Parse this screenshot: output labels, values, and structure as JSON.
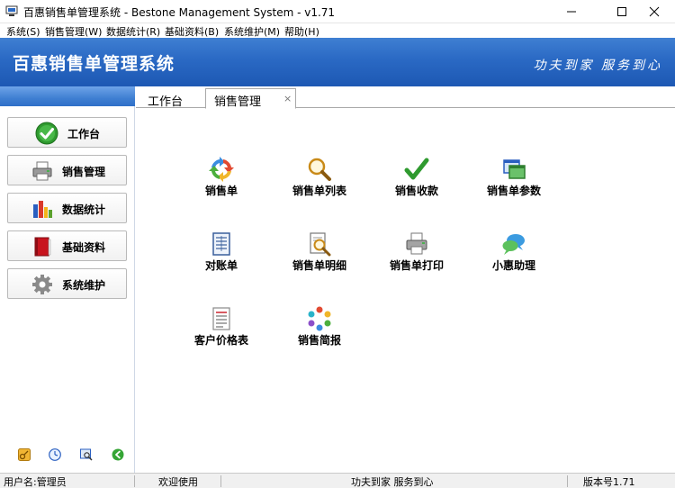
{
  "window": {
    "title": "百惠销售单管理系统 - Bestone Management System - v1.71",
    "minimize_icon": "minimize-icon",
    "maximize_icon": "maximize-icon",
    "close_icon": "close-icon"
  },
  "menu": [
    {
      "label": "系统(S)"
    },
    {
      "label": "销售管理(W)"
    },
    {
      "label": "数据统计(R)"
    },
    {
      "label": "基础资料(B)"
    },
    {
      "label": "系统维护(M)"
    },
    {
      "label": "帮助(H)"
    }
  ],
  "banner": {
    "title": "百惠销售单管理系统",
    "slogan": "功夫到家 服务到心",
    "color": "#2a69c4"
  },
  "sidebar": {
    "items": [
      {
        "label": "工作台",
        "icon": "checkmark-icon"
      },
      {
        "label": "销售管理",
        "icon": "printer-icon"
      },
      {
        "label": "数据统计",
        "icon": "bar-chart-icon"
      },
      {
        "label": "基础资料",
        "icon": "book-icon"
      },
      {
        "label": "系统维护",
        "icon": "gear-icon"
      }
    ],
    "tools": [
      "key-icon",
      "clock-icon",
      "search-window-icon",
      "back-icon"
    ]
  },
  "tabs": {
    "workbench": "工作台",
    "sales": "销售管理",
    "close": "×"
  },
  "tiles": [
    {
      "label": "销售单",
      "icon": "refresh-arrows-icon"
    },
    {
      "label": "销售单列表",
      "icon": "magnifier-icon"
    },
    {
      "label": "销售收款",
      "icon": "checkmark-icon"
    },
    {
      "label": "销售单参数",
      "icon": "windows-icon"
    },
    {
      "label": "对账单",
      "icon": "ledger-icon"
    },
    {
      "label": "销售单明细",
      "icon": "document-search-icon"
    },
    {
      "label": "销售单打印",
      "icon": "printer-icon"
    },
    {
      "label": "小惠助理",
      "icon": "chat-bubbles-icon"
    },
    {
      "label": "客户价格表",
      "icon": "price-list-icon"
    },
    {
      "label": "销售简报",
      "icon": "ring-icon"
    }
  ],
  "status": {
    "user": "用户名:管理员",
    "welcome": "欢迎使用",
    "slogan": "功夫到家 服务到心",
    "version": "版本号1.71"
  }
}
